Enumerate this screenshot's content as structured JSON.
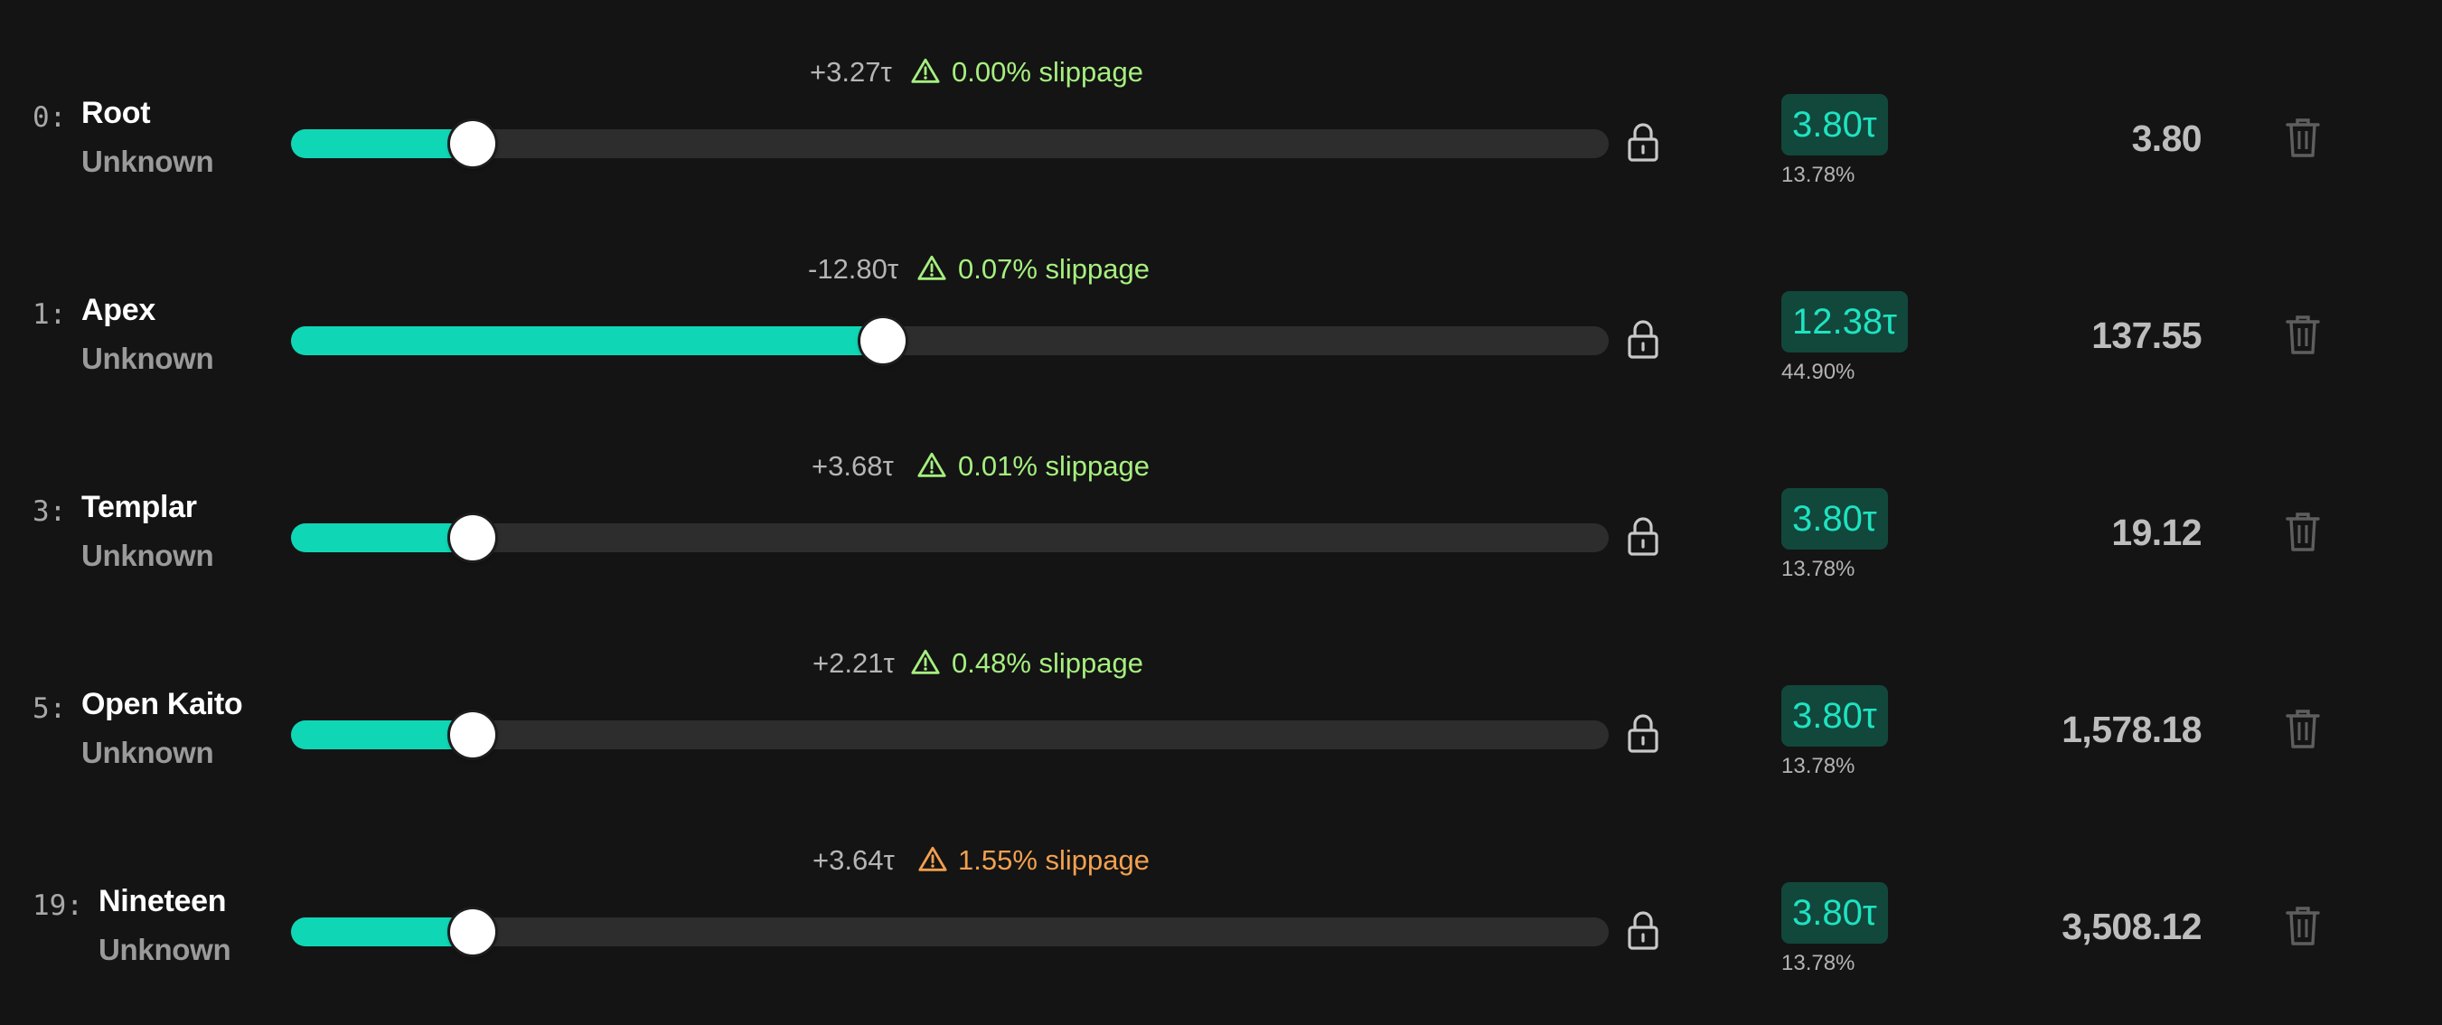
{
  "rows": [
    {
      "id": "0:",
      "name": "Root",
      "owner": "Unknown",
      "delta": "+3.27τ",
      "slippage": "0.00% slippage",
      "slippage_level": "ok",
      "slider_fraction": 0.138,
      "stake": "3.80τ",
      "share": "13.78%",
      "amount": "3.80"
    },
    {
      "id": "1:",
      "name": "Apex",
      "owner": "Unknown",
      "delta": "-12.80τ",
      "slippage": "0.07% slippage",
      "slippage_level": "ok",
      "slider_fraction": 0.449,
      "stake": "12.38τ",
      "share": "44.90%",
      "amount": "137.55"
    },
    {
      "id": "3:",
      "name": "Templar",
      "owner": "Unknown",
      "delta": "+3.68τ",
      "slippage": "0.01% slippage",
      "slippage_level": "ok",
      "slider_fraction": 0.138,
      "stake": "3.80τ",
      "share": "13.78%",
      "amount": "19.12"
    },
    {
      "id": "5:",
      "name": "Open Kaito",
      "owner": "Unknown",
      "delta": "+2.21τ",
      "slippage": "0.48% slippage",
      "slippage_level": "ok",
      "slider_fraction": 0.138,
      "stake": "3.80τ",
      "share": "13.78%",
      "amount": "1,578.18"
    },
    {
      "id": "19:",
      "name": "Nineteen",
      "owner": "Unknown",
      "delta": "+3.64τ",
      "slippage": "1.55% slippage",
      "slippage_level": "high",
      "slider_fraction": 0.138,
      "stake": "3.80τ",
      "share": "13.78%",
      "amount": "3,508.12"
    }
  ],
  "colors": {
    "background": "#141414",
    "accent": "#0fd7b6",
    "slippage_ok": "#a6ef7f",
    "slippage_high": "#f3a04f"
  },
  "icons": {
    "warning": "warning-triangle-icon",
    "lock": "lock-icon",
    "delete": "trash-icon"
  }
}
